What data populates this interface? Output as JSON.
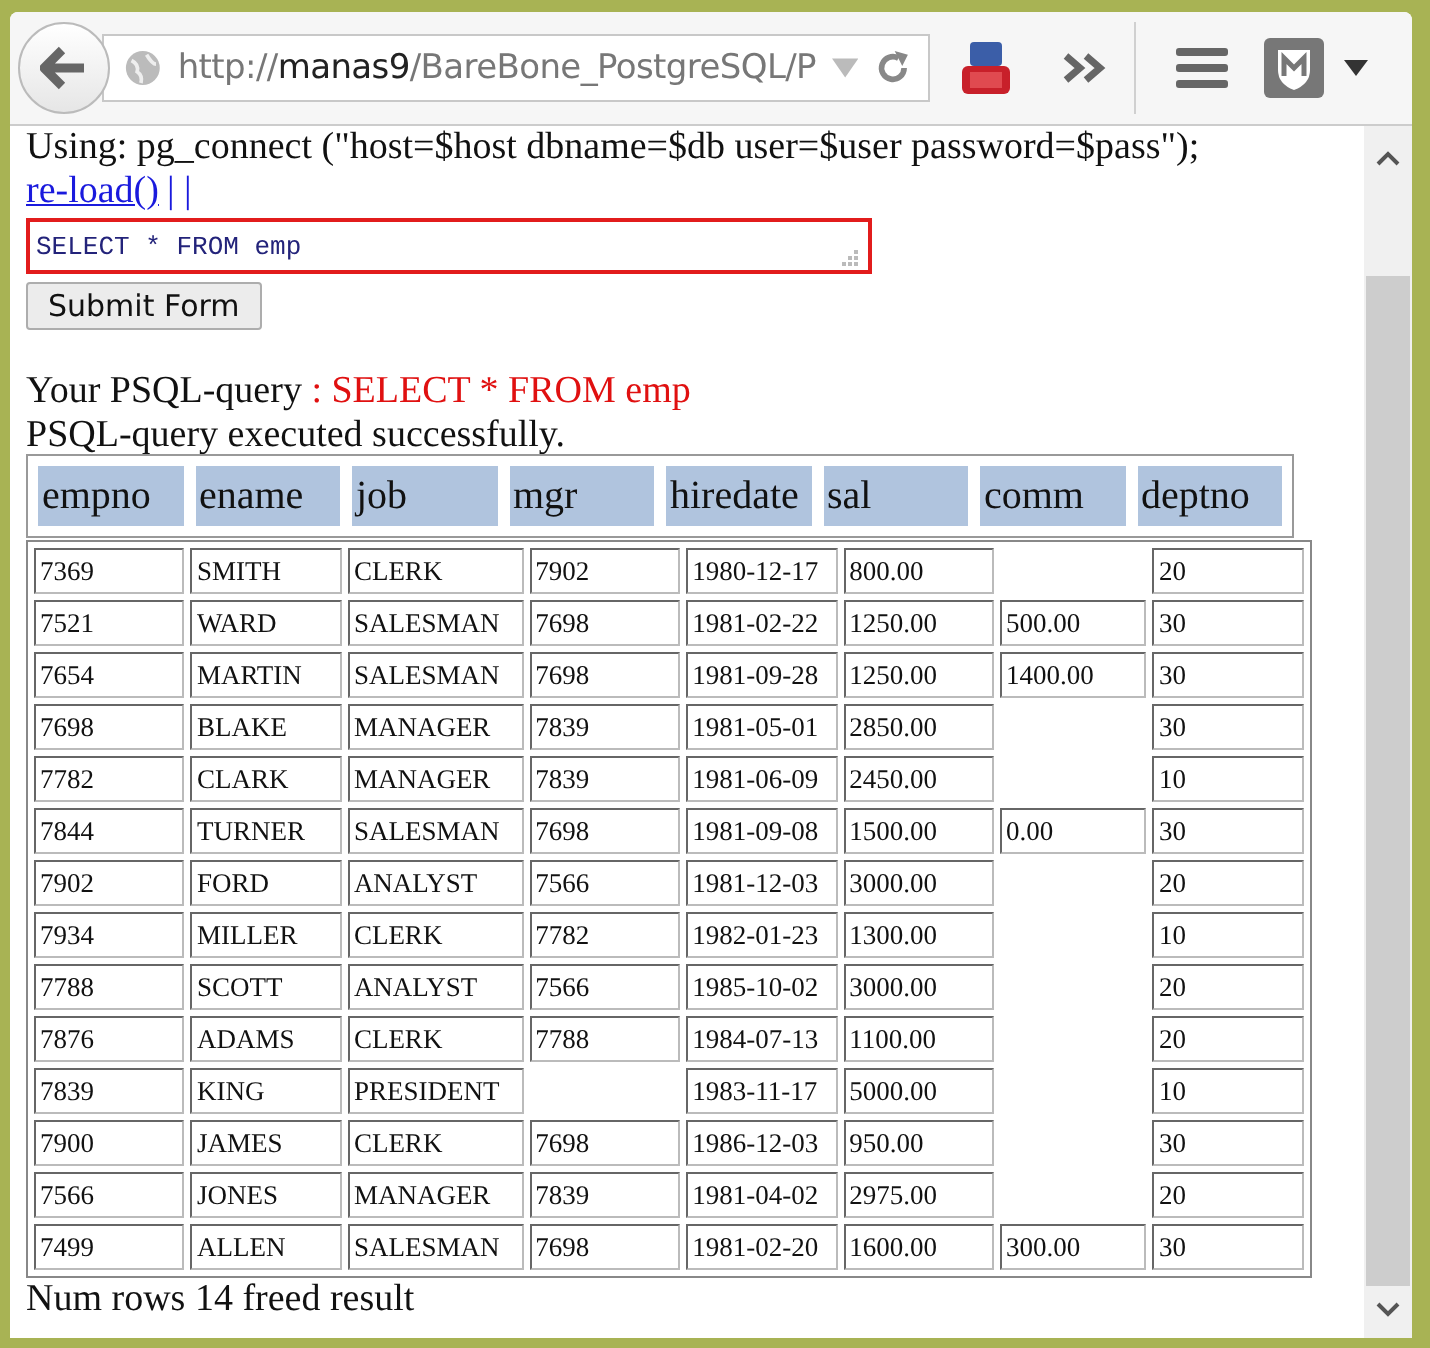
{
  "toolbar": {
    "url_prefix": "http://",
    "url_host": "manas9",
    "url_path": "/BareBone_PostgreSQL/P"
  },
  "page": {
    "using_line": "Using: pg_connect (\"host=$host dbname=$db user=$user password=$pass\");",
    "reload_link": "re-load()",
    "separators": "| |",
    "query_value": "SELECT * FROM emp",
    "submit_button": "Submit Form",
    "query_label": "Your PSQL-query",
    "query_echo": ": SELECT * FROM emp",
    "status": "PSQL-query executed successfully.",
    "footer": "Num rows 14 freed result"
  },
  "table": {
    "columns": [
      "empno",
      "ename",
      "job",
      "mgr",
      "hiredate",
      "sal",
      "comm",
      "deptno"
    ],
    "rows": [
      [
        "7369",
        "SMITH",
        "CLERK",
        "7902",
        "1980-12-17",
        "800.00",
        null,
        "20"
      ],
      [
        "7521",
        "WARD",
        "SALESMAN",
        "7698",
        "1981-02-22",
        "1250.00",
        "500.00",
        "30"
      ],
      [
        "7654",
        "MARTIN",
        "SALESMAN",
        "7698",
        "1981-09-28",
        "1250.00",
        "1400.00",
        "30"
      ],
      [
        "7698",
        "BLAKE",
        "MANAGER",
        "7839",
        "1981-05-01",
        "2850.00",
        null,
        "30"
      ],
      [
        "7782",
        "CLARK",
        "MANAGER",
        "7839",
        "1981-06-09",
        "2450.00",
        null,
        "10"
      ],
      [
        "7844",
        "TURNER",
        "SALESMAN",
        "7698",
        "1981-09-08",
        "1500.00",
        "0.00",
        "30"
      ],
      [
        "7902",
        "FORD",
        "ANALYST",
        "7566",
        "1981-12-03",
        "3000.00",
        null,
        "20"
      ],
      [
        "7934",
        "MILLER",
        "CLERK",
        "7782",
        "1982-01-23",
        "1300.00",
        null,
        "10"
      ],
      [
        "7788",
        "SCOTT",
        "ANALYST",
        "7566",
        "1985-10-02",
        "3000.00",
        null,
        "20"
      ],
      [
        "7876",
        "ADAMS",
        "CLERK",
        "7788",
        "1984-07-13",
        "1100.00",
        null,
        "20"
      ],
      [
        "7839",
        "KING",
        "PRESIDENT",
        null,
        "1983-11-17",
        "5000.00",
        null,
        "10"
      ],
      [
        "7900",
        "JAMES",
        "CLERK",
        "7698",
        "1986-12-03",
        "950.00",
        null,
        "30"
      ],
      [
        "7566",
        "JONES",
        "MANAGER",
        "7839",
        "1981-04-02",
        "2975.00",
        null,
        "20"
      ],
      [
        "7499",
        "ALLEN",
        "SALESMAN",
        "7698",
        "1981-02-20",
        "1600.00",
        "300.00",
        "30"
      ]
    ]
  }
}
